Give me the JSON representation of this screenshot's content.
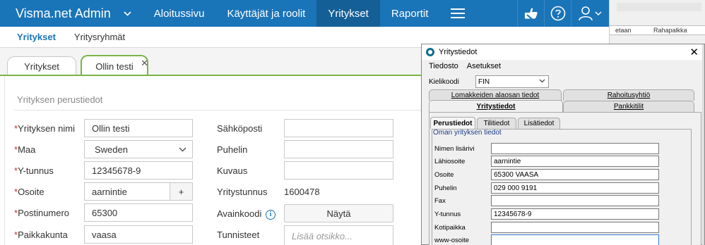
{
  "topbar": {
    "brand": "Visma.net Admin",
    "nav": [
      "Aloitussivu",
      "Käyttäjät ja roolit",
      "Yritykset",
      "Raportit"
    ]
  },
  "subnav": {
    "item1": "Yritykset",
    "item2": "Yritysryhmät"
  },
  "tabs": {
    "tab1": "Yritykset",
    "tab2": "Ollin testi",
    "close": "✕"
  },
  "section": {
    "title": "Yrityksen perustiedot"
  },
  "form": {
    "left": [
      {
        "label": "Yrityksen nimi",
        "value": "Ollin testi"
      },
      {
        "label": "Maa",
        "value": "Sweden"
      },
      {
        "label": "Y-tunnus",
        "value": "12345678-9"
      },
      {
        "label": "Osoite",
        "value": "aarnintie"
      },
      {
        "label": "Postinumero",
        "value": "65300"
      },
      {
        "label": "Paikkakunta",
        "value": "vaasa"
      }
    ],
    "right": {
      "email_label": "Sähköposti",
      "phone_label": "Puhelin",
      "desc_label": "Kuvaus",
      "company_id_label": "Yritystunnus",
      "company_id_value": "1600478",
      "key_label": "Avainkoodi",
      "key_button": "Näytä",
      "tags_label": "Tunnisteet",
      "tags_placeholder": "Lisää otsikko..."
    },
    "required_mark": "*",
    "plus": "+"
  },
  "background_sheet": {
    "col1": "etaan",
    "col2": "Rahapalkka"
  },
  "dialog": {
    "title": "Yritystiedot",
    "menu": [
      "Tiedosto",
      "Asetukset"
    ],
    "language_label": "Kielikoodi",
    "language_value": "FIN",
    "tabs_row1": [
      "Lomakkeiden alaosan tiedot",
      "Rahoitusyhtiö"
    ],
    "tabs_row2": [
      "Yritystiedot",
      "Pankkitilit"
    ],
    "subtabs": [
      "Perustiedot",
      "Tilitiedot",
      "Lisätiedot"
    ],
    "group_title": "Oman yrityksen tiedot",
    "fields": [
      {
        "label": "Nimen lisärivi",
        "value": ""
      },
      {
        "label": "Lähiosoite",
        "value": "aarnintie"
      },
      {
        "label": "Osoite",
        "value": "65300 VAASA"
      },
      {
        "label": "Puhelin",
        "value": "029 000 9191"
      },
      {
        "label": "Fax",
        "value": ""
      },
      {
        "label": "Y-tunnus",
        "value": "12345678-9"
      },
      {
        "label": "Kotipaikka",
        "value": ""
      },
      {
        "label": "www-osoite",
        "value": ""
      }
    ]
  }
}
